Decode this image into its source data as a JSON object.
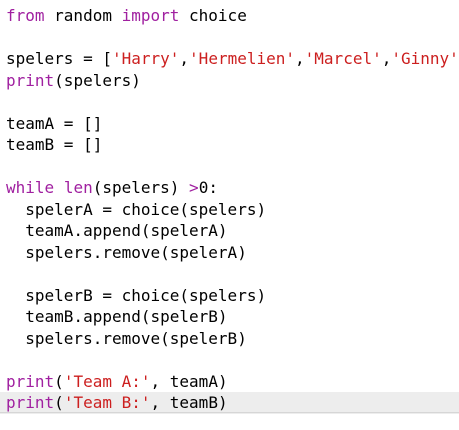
{
  "editor": {
    "current_line_index": 18,
    "colors": {
      "keyword": "#a020a0",
      "string": "#cc1f1f",
      "text": "#000000",
      "current_line_bg": "#ededed"
    },
    "lines": [
      [
        {
          "t": "kw",
          "v": "from"
        },
        {
          "t": "tx",
          "v": " random "
        },
        {
          "t": "kw",
          "v": "import"
        },
        {
          "t": "tx",
          "v": " choice"
        }
      ],
      [],
      [
        {
          "t": "tx",
          "v": "spelers = ["
        },
        {
          "t": "str",
          "v": "'Harry'"
        },
        {
          "t": "tx",
          "v": ","
        },
        {
          "t": "str",
          "v": "'Hermelien'"
        },
        {
          "t": "tx",
          "v": ","
        },
        {
          "t": "str",
          "v": "'Marcel'"
        },
        {
          "t": "tx",
          "v": ","
        },
        {
          "t": "str",
          "v": "'Ginny'"
        },
        {
          "t": "tx",
          "v": "]"
        }
      ],
      [
        {
          "t": "kw",
          "v": "print"
        },
        {
          "t": "tx",
          "v": "(spelers)"
        }
      ],
      [],
      [
        {
          "t": "tx",
          "v": "teamA = []"
        }
      ],
      [
        {
          "t": "tx",
          "v": "teamB = []"
        }
      ],
      [],
      [
        {
          "t": "kw",
          "v": "while"
        },
        {
          "t": "tx",
          "v": " "
        },
        {
          "t": "kw",
          "v": "len"
        },
        {
          "t": "tx",
          "v": "(spelers) "
        },
        {
          "t": "kw",
          "v": ">"
        },
        {
          "t": "tx",
          "v": "0:"
        }
      ],
      [
        {
          "t": "tx",
          "v": "  spelerA = choice(spelers)"
        }
      ],
      [
        {
          "t": "tx",
          "v": "  teamA.append(spelerA)"
        }
      ],
      [
        {
          "t": "tx",
          "v": "  spelers.remove(spelerA)"
        }
      ],
      [],
      [
        {
          "t": "tx",
          "v": "  spelerB = choice(spelers)"
        }
      ],
      [
        {
          "t": "tx",
          "v": "  teamB.append(spelerB)"
        }
      ],
      [
        {
          "t": "tx",
          "v": "  spelers.remove(spelerB)"
        }
      ],
      [],
      [
        {
          "t": "kw",
          "v": "print"
        },
        {
          "t": "tx",
          "v": "("
        },
        {
          "t": "str",
          "v": "'Team A:'"
        },
        {
          "t": "tx",
          "v": ", teamA)"
        }
      ],
      [
        {
          "t": "kw",
          "v": "print"
        },
        {
          "t": "tx",
          "v": "("
        },
        {
          "t": "str",
          "v": "'Team B:'"
        },
        {
          "t": "tx",
          "v": ", teamB)"
        }
      ]
    ]
  }
}
